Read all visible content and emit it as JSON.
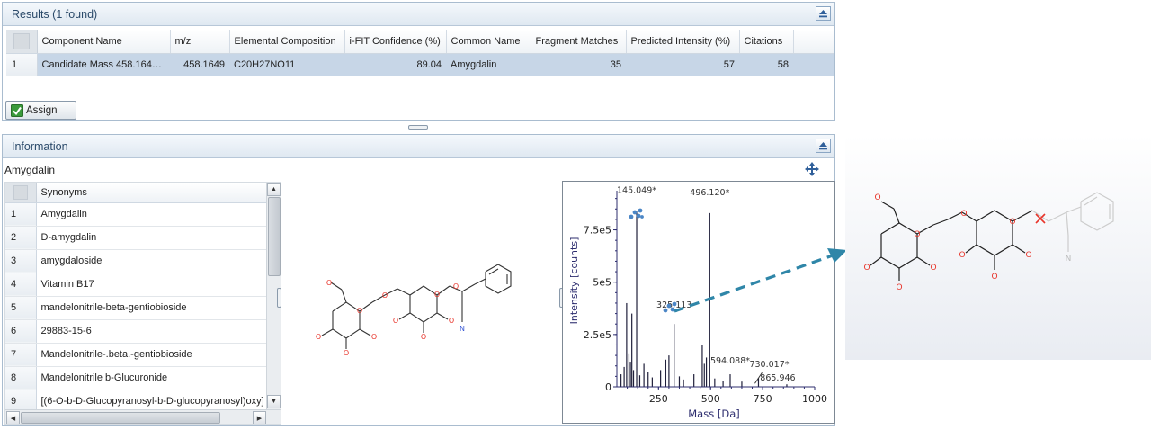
{
  "results": {
    "title": "Results (1 found)",
    "columns": [
      "Component Name",
      "m/z",
      "Elemental Composition",
      "i-FIT Confidence (%)",
      "Common Name",
      "Fragment Matches",
      "Predicted Intensity (%)",
      "Citations"
    ],
    "rows": [
      {
        "index": "1",
        "component_name": "Candidate Mass 458.16486...",
        "mz": "458.1649",
        "composition": "C20H27NO11",
        "ifit": "89.04",
        "common_name": "Amygdalin",
        "fragment_matches": "35",
        "predicted_intensity": "57",
        "citations": "58"
      }
    ],
    "assign_label": "Assign"
  },
  "information": {
    "title": "Information",
    "compound": "Amygdalin",
    "synonyms_header": "Synonyms",
    "synonyms": [
      {
        "index": "1",
        "name": "Amygdalin"
      },
      {
        "index": "2",
        "name": "D-amygdalin"
      },
      {
        "index": "3",
        "name": "amygdaloside"
      },
      {
        "index": "4",
        "name": "Vitamin B17"
      },
      {
        "index": "5",
        "name": "mandelonitrile-beta-gentiobioside"
      },
      {
        "index": "6",
        "name": "29883-15-6"
      },
      {
        "index": "7",
        "name": "Mandelonitrile-.beta.-gentiobioside"
      },
      {
        "index": "8",
        "name": "Mandelonitrile b-Glucuronide"
      },
      {
        "index": "9",
        "name": "[(6-O-b-D-Glucopyranosyl-b-D-glucopyranosyl)oxy]"
      }
    ]
  },
  "colors": {
    "accent": "#2f86a8",
    "bar": "#1f1f3a",
    "axis": "#2c2c6e",
    "oxygen": "#e8342a",
    "nitrogen": "#3b5bd6",
    "label": "#333333"
  },
  "icons": [
    "collapse-up-icon",
    "checkbox-icon",
    "move-icon",
    "fragment-icon",
    "arrow-right-icon"
  ],
  "chart_data": {
    "type": "bar",
    "xlabel": "Mass [Da]",
    "ylabel": "Intensity [counts]",
    "xlim": [
      50,
      1000
    ],
    "ylim": [
      0,
      920000
    ],
    "xticks": [
      "250",
      "500",
      "750",
      "1000"
    ],
    "yticks": [
      "0",
      "2.5e5",
      "5e5",
      "7.5e5"
    ],
    "xticks_values": [
      250,
      500,
      750,
      1000
    ],
    "yticks_values": [
      0,
      250000,
      500000,
      750000
    ],
    "peaks": [
      {
        "x": 70,
        "y": 60000
      },
      {
        "x": 85,
        "y": 95000
      },
      {
        "x": 97,
        "y": 400000
      },
      {
        "x": 108,
        "y": 160000
      },
      {
        "x": 115,
        "y": 120000
      },
      {
        "x": 122,
        "y": 350000
      },
      {
        "x": 130,
        "y": 80000
      },
      {
        "x": 145.049,
        "y": 840000
      },
      {
        "x": 160,
        "y": 55000
      },
      {
        "x": 180,
        "y": 110000
      },
      {
        "x": 200,
        "y": 70000
      },
      {
        "x": 220,
        "y": 45000
      },
      {
        "x": 260,
        "y": 80000
      },
      {
        "x": 285,
        "y": 130000
      },
      {
        "x": 300,
        "y": 150000
      },
      {
        "x": 325.113,
        "y": 300000
      },
      {
        "x": 350,
        "y": 50000
      },
      {
        "x": 370,
        "y": 35000
      },
      {
        "x": 420,
        "y": 60000
      },
      {
        "x": 460,
        "y": 200000
      },
      {
        "x": 470,
        "y": 110000
      },
      {
        "x": 480,
        "y": 140000
      },
      {
        "x": 496.12,
        "y": 830000
      },
      {
        "x": 520,
        "y": 40000
      },
      {
        "x": 560,
        "y": 30000
      },
      {
        "x": 594.088,
        "y": 60000
      },
      {
        "x": 650,
        "y": 25000
      },
      {
        "x": 730.017,
        "y": 42000
      },
      {
        "x": 865.946,
        "y": 12000
      }
    ],
    "labels": [
      {
        "x": 145.049,
        "y": 840000,
        "text": "145.049*"
      },
      {
        "x": 496.12,
        "y": 830000,
        "text": "496.120*"
      },
      {
        "x": 325.113,
        "y": 300000,
        "text": "325.113"
      },
      {
        "x": 594.088,
        "y": 60000,
        "text": "594.088*"
      },
      {
        "x": 730.017,
        "y": 42000,
        "text": "730.017*"
      },
      {
        "x": 865.946,
        "y": 12000,
        "text": "865.946"
      }
    ]
  }
}
